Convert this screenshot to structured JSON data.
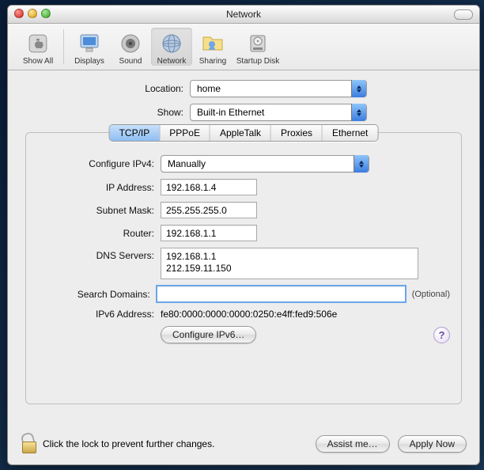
{
  "window": {
    "title": "Network"
  },
  "toolbar": {
    "items": [
      {
        "label": "Show All"
      },
      {
        "label": "Displays"
      },
      {
        "label": "Sound"
      },
      {
        "label": "Network"
      },
      {
        "label": "Sharing"
      },
      {
        "label": "Startup Disk"
      }
    ]
  },
  "selectors": {
    "location_label": "Location:",
    "location_value": "home",
    "show_label": "Show:",
    "show_value": "Built-in Ethernet"
  },
  "tabs": [
    "TCP/IP",
    "PPPoE",
    "AppleTalk",
    "Proxies",
    "Ethernet"
  ],
  "form": {
    "configure_label": "Configure IPv4:",
    "configure_value": "Manually",
    "ip_label": "IP Address:",
    "ip_value": "192.168.1.4",
    "subnet_label": "Subnet Mask:",
    "subnet_value": "255.255.255.0",
    "router_label": "Router:",
    "router_value": "192.168.1.1",
    "dns_label": "DNS Servers:",
    "dns_value": "192.168.1.1\n212.159.11.150",
    "search_label": "Search Domains:",
    "search_value": "",
    "optional": "(Optional)",
    "ipv6_addr_label": "IPv6 Address:",
    "ipv6_addr_value": "fe80:0000:0000:0000:0250:e4ff:fed9:506e",
    "configure_ipv6_btn": "Configure IPv6…"
  },
  "footer": {
    "lock_text": "Click the lock to prevent further changes.",
    "assist_btn": "Assist me…",
    "apply_btn": "Apply Now"
  },
  "help": "?"
}
